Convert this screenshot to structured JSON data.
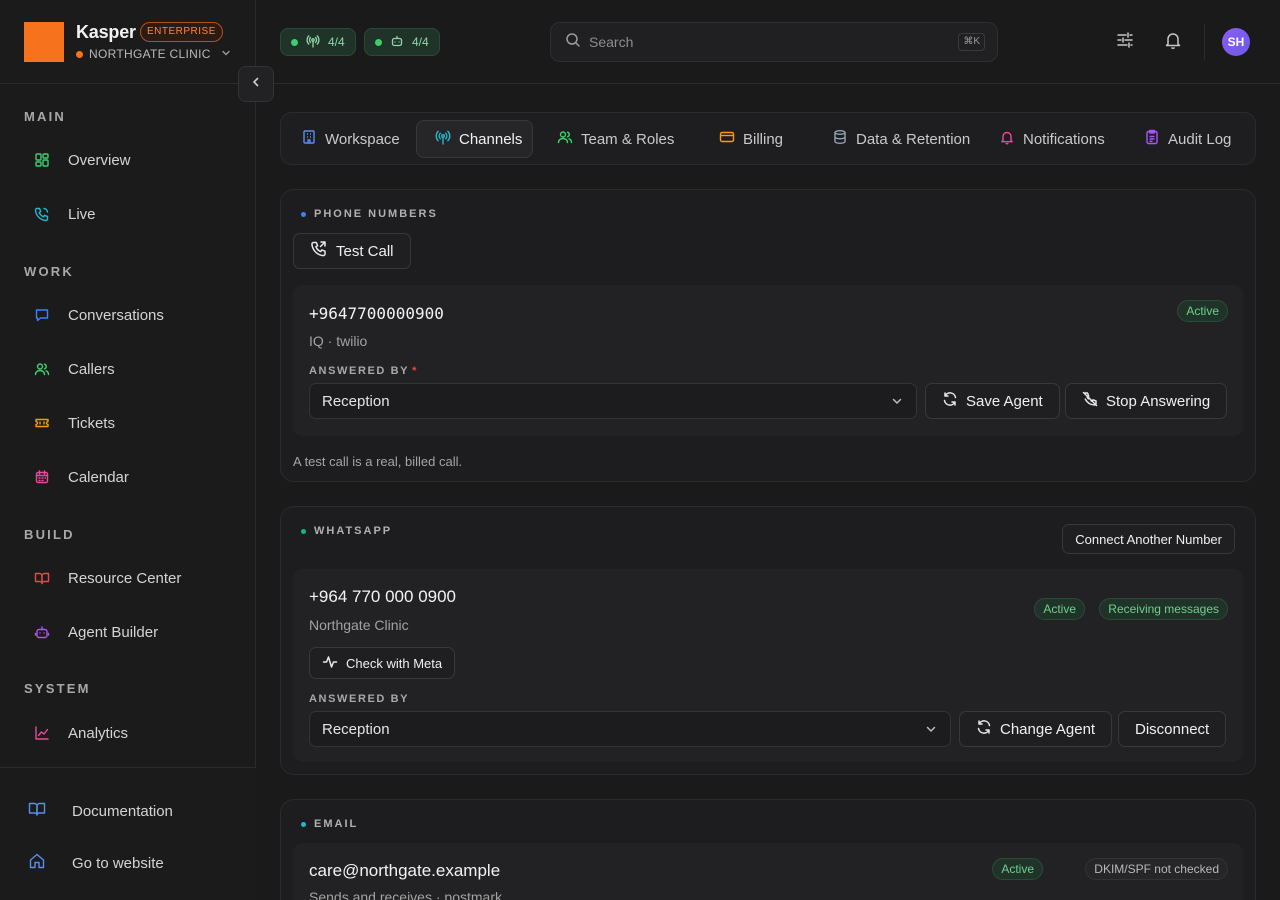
{
  "app": {
    "name": "Kasper",
    "plan": "ENTERPRISE",
    "org": "NORTHGATE CLINIC",
    "brand_color": "#f7721c"
  },
  "topbar": {
    "stats": [
      {
        "icon": "antenna-icon",
        "value": "4/4"
      },
      {
        "icon": "bot-icon",
        "value": "4/4"
      }
    ],
    "search_placeholder": "Search",
    "search_shortcut": "⌘K",
    "avatar_initials": "SH"
  },
  "sidebar": {
    "sections": [
      {
        "title": "MAIN",
        "items": [
          {
            "label": "Overview",
            "icon": "grid-icon",
            "color": "#3ccf6c"
          },
          {
            "label": "Live",
            "icon": "phone-live-icon",
            "color": "#22b8cf"
          }
        ]
      },
      {
        "title": "WORK",
        "items": [
          {
            "label": "Conversations",
            "icon": "chat-icon",
            "color": "#3b82f6"
          },
          {
            "label": "Callers",
            "icon": "users-icon",
            "color": "#3ccf6c"
          },
          {
            "label": "Tickets",
            "icon": "ticket-icon",
            "color": "#f59e0b"
          },
          {
            "label": "Calendar",
            "icon": "calendar-icon",
            "color": "#ec4899"
          }
        ]
      },
      {
        "title": "BUILD",
        "items": [
          {
            "label": "Resource Center",
            "icon": "book-icon",
            "color": "#ef4444"
          },
          {
            "label": "Agent Builder",
            "icon": "bot-icon",
            "color": "#a855f7"
          }
        ]
      },
      {
        "title": "SYSTEM",
        "items": [
          {
            "label": "Analytics",
            "icon": "chart-icon",
            "color": "#ec4899"
          }
        ]
      }
    ],
    "footer": [
      {
        "label": "Documentation",
        "icon": "docs-icon"
      },
      {
        "label": "Go to website",
        "icon": "home-icon"
      }
    ]
  },
  "tabs": [
    {
      "label": "Workspace",
      "icon": "building-icon",
      "color": "#5b8def",
      "active": false
    },
    {
      "label": "Channels",
      "icon": "antenna-icon",
      "color": "#22b8cf",
      "active": true
    },
    {
      "label": "Team & Roles",
      "icon": "users-icon",
      "color": "#3ccf6c",
      "active": false
    },
    {
      "label": "Billing",
      "icon": "card-icon",
      "color": "#f59e0b",
      "active": false
    },
    {
      "label": "Data & Retention",
      "icon": "database-icon",
      "color": "#94a3b8",
      "active": false
    },
    {
      "label": "Notifications",
      "icon": "bell-icon",
      "color": "#ec4899",
      "active": false
    },
    {
      "label": "Audit Log",
      "icon": "clipboard-icon",
      "color": "#a855f7",
      "active": false
    }
  ],
  "phone": {
    "section_title": "PHONE NUMBERS",
    "dot_color": "#3b82f6",
    "test_call_label": "Test Call",
    "number": "+9647700000900",
    "meta": "IQ · twilio",
    "status": "Active",
    "answered_by_label": "ANSWERED BY",
    "required_mark": "*",
    "agent": "Reception",
    "save_label": "Save Agent",
    "stop_label": "Stop Answering",
    "note": "A test call is a real, billed call."
  },
  "whatsapp": {
    "section_title": "WHATSAPP",
    "dot_color": "#10b981",
    "connect_label": "Connect Another Number",
    "number": "+964 770 000 0900",
    "name": "Northgate Clinic",
    "status": "Active",
    "status2": "Receiving messages",
    "check_label": "Check with Meta",
    "answered_by_label": "ANSWERED BY",
    "agent": "Reception",
    "change_label": "Change Agent",
    "disconnect_label": "Disconnect"
  },
  "email": {
    "section_title": "EMAIL",
    "dot_color": "#22b8cf",
    "address": "care@northgate.example",
    "meta": "Sends and receives · postmark",
    "status": "Active",
    "dkim": "DKIM/SPF not checked"
  }
}
